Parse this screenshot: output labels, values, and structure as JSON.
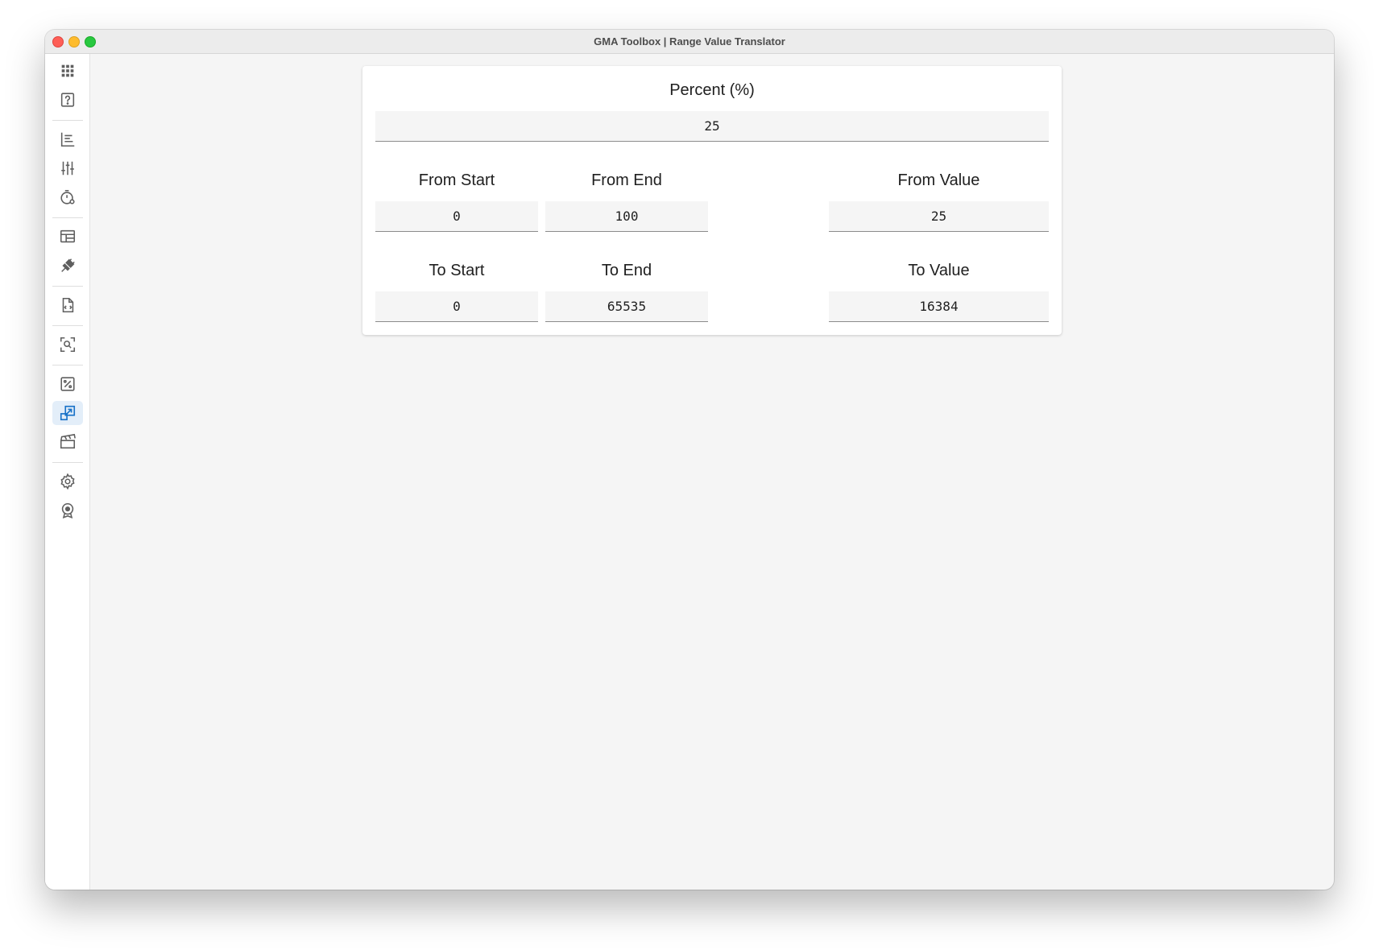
{
  "window": {
    "title": "GMA Toolbox | Range Value Translator"
  },
  "sidebar": {
    "active_color": "#1a73c8",
    "icon_color": "#5f5f5f",
    "items": [
      {
        "icon": "grid-icon"
      },
      {
        "icon": "help-icon"
      },
      {
        "icon": "bar-list-icon"
      },
      {
        "icon": "sliders-icon"
      },
      {
        "icon": "timer-icon"
      },
      {
        "icon": "table-icon"
      },
      {
        "icon": "plug-icon"
      },
      {
        "icon": "file-code-icon"
      },
      {
        "icon": "search-scan-icon"
      },
      {
        "icon": "percent-icon"
      },
      {
        "icon": "range-translate-icon",
        "active": true
      },
      {
        "icon": "clapperboard-icon"
      },
      {
        "icon": "gear-icon"
      },
      {
        "icon": "award-icon"
      }
    ]
  },
  "percent": {
    "label": "Percent (%)",
    "value": "25"
  },
  "from": {
    "start_label": "From Start",
    "start_value": "0",
    "end_label": "From End",
    "end_value": "100",
    "value_label": "From Value",
    "value": "25"
  },
  "to": {
    "start_label": "To Start",
    "start_value": "0",
    "end_label": "To End",
    "end_value": "65535",
    "value_label": "To Value",
    "value": "16384"
  }
}
